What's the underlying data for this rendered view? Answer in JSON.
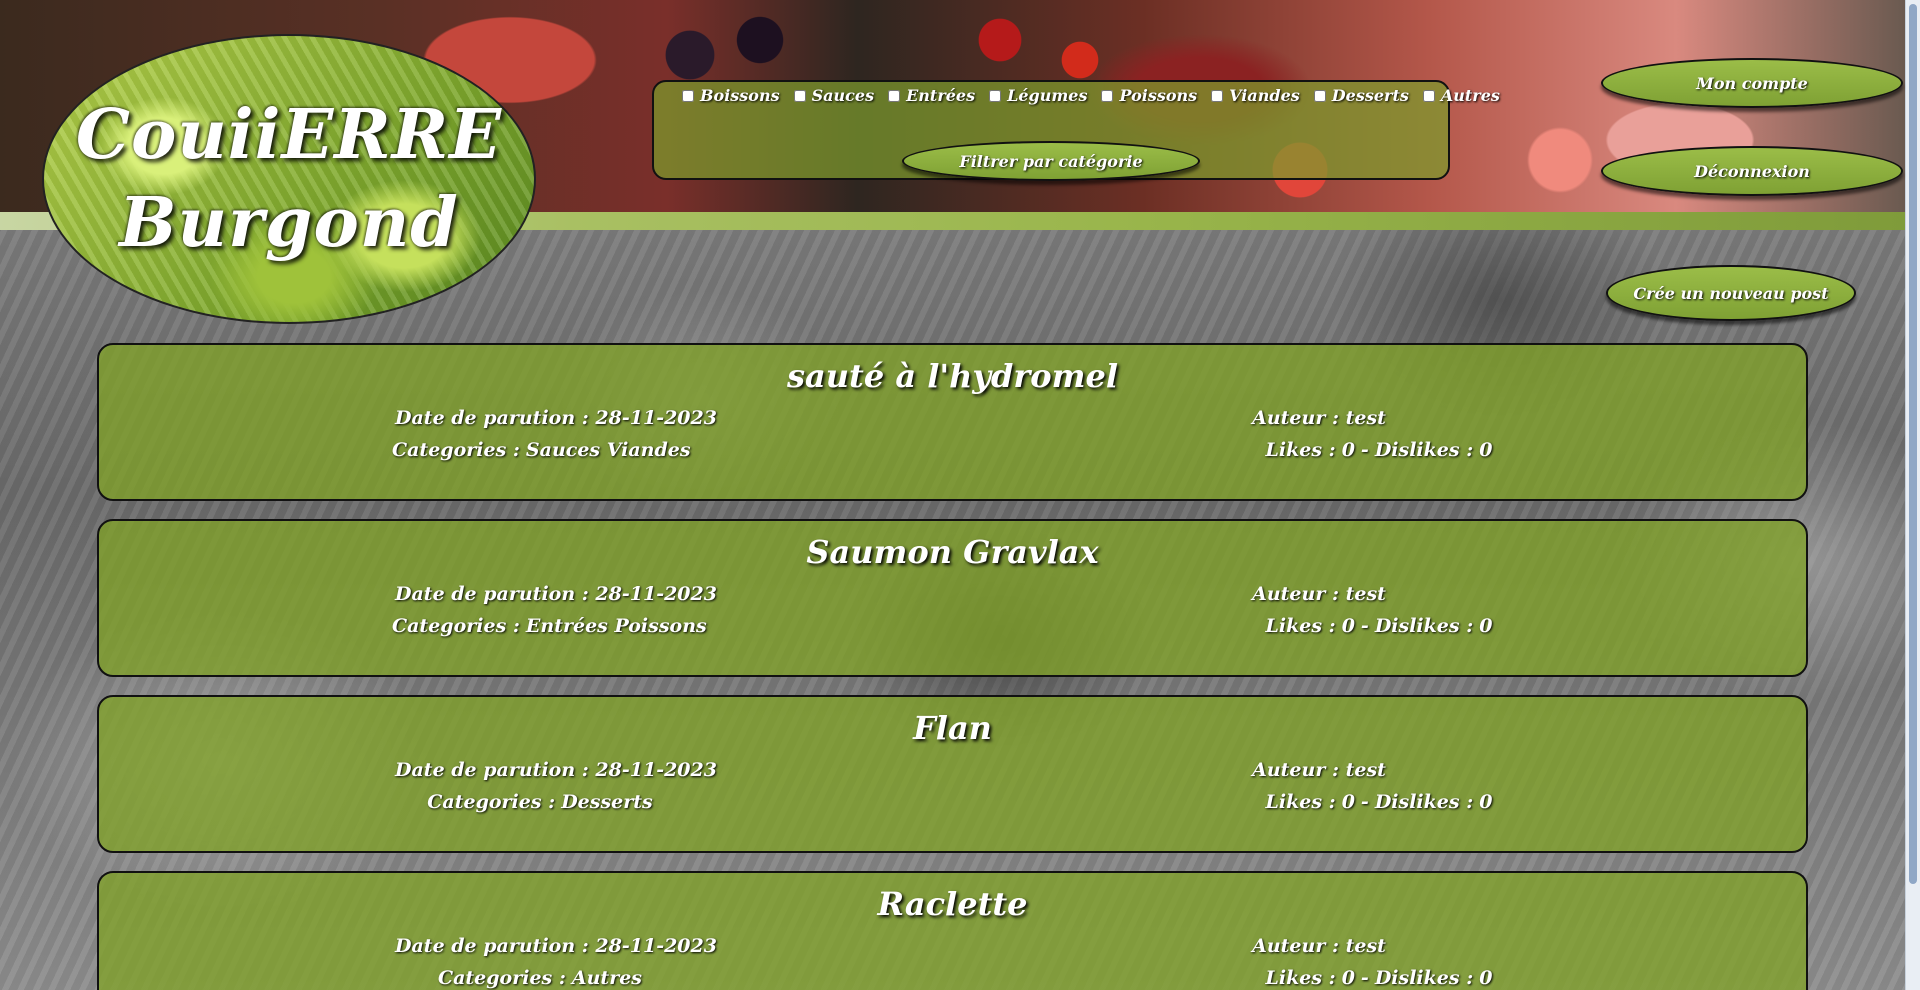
{
  "logo": {
    "line1": "CouiiERRE",
    "line2": "Burgond"
  },
  "filter": {
    "categories": [
      "Boissons",
      "Sauces",
      "Entrées",
      "Légumes",
      "Poissons",
      "Viandes",
      "Desserts",
      "Autres"
    ],
    "button_label": "Filtrer par catégorie"
  },
  "account": {
    "my_account_label": "Mon compte",
    "logout_label": "Déconnexion"
  },
  "new_post_label": "Crée un nouveau post",
  "post_labels": {
    "date": "Date de parution :",
    "categories": "Categories :",
    "author": "Auteur :",
    "likes": "Likes :",
    "dislikes": "Dislikes :",
    "separator": "-"
  },
  "posts": [
    {
      "title": "sauté à l'hydromel",
      "date": "28-11-2023",
      "categories": "Sauces  Viandes",
      "author": "test",
      "likes": "0",
      "dislikes": "0"
    },
    {
      "title": "Saumon Gravlax",
      "date": "28-11-2023",
      "categories": "Entrées  Poissons",
      "author": "test",
      "likes": "0",
      "dislikes": "0"
    },
    {
      "title": "Flan",
      "date": "28-11-2023",
      "categories": "Desserts",
      "author": "test",
      "likes": "0",
      "dislikes": "0"
    },
    {
      "title": "Raclette",
      "date": "28-11-2023",
      "categories": "Autres",
      "author": "test",
      "likes": "0",
      "dislikes": "0"
    }
  ]
}
